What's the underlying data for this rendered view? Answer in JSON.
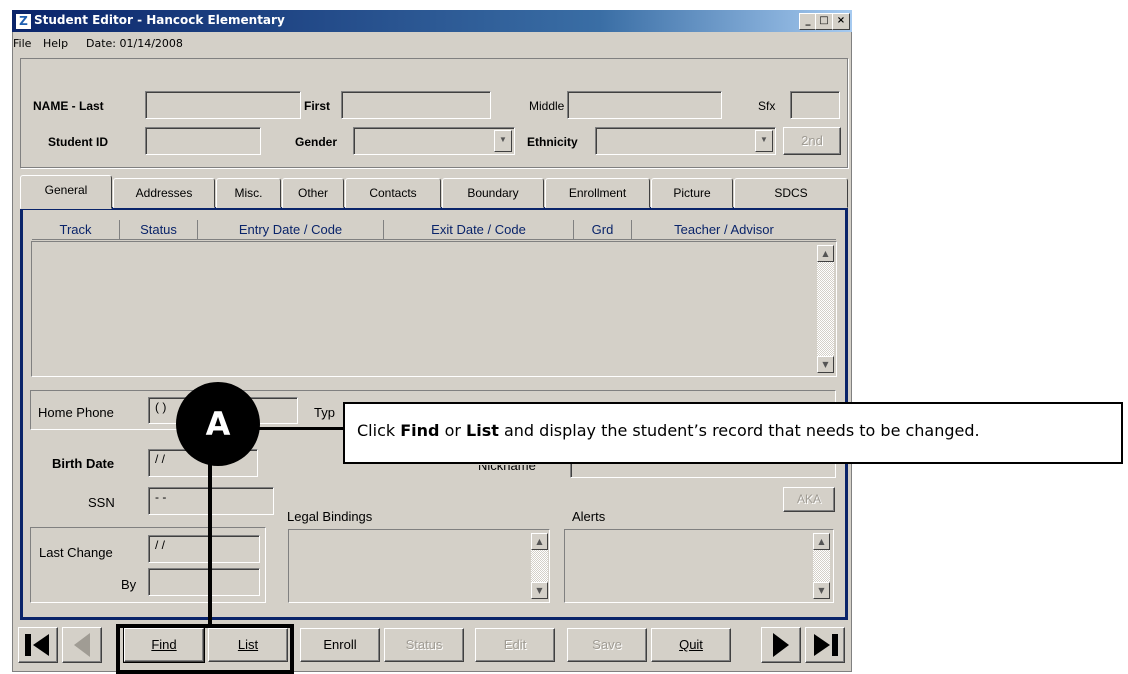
{
  "window": {
    "title": "Student Editor - Hancock Elementary",
    "app_icon": "Z"
  },
  "menu": {
    "file": "File",
    "help": "Help",
    "date": "Date: 01/14/2008"
  },
  "name_row": {
    "last_label": "NAME - Last",
    "first_label": "First",
    "middle_label": "Middle",
    "sfx_label": "Sfx"
  },
  "id_row": {
    "student_id_label": "Student ID",
    "gender_label": "Gender",
    "ethnicity_label": "Ethnicity",
    "second_button": "2nd"
  },
  "tabs": [
    "General",
    "Addresses",
    "Misc.",
    "Other",
    "Contacts",
    "Boundary",
    "Enrollment",
    "Picture",
    "SDCS"
  ],
  "table": {
    "columns": [
      "Track",
      "Status",
      "Entry Date / Code",
      "Exit Date / Code",
      "Grd",
      "Teacher / Advisor"
    ]
  },
  "general": {
    "home_phone_label": "Home Phone",
    "home_phone_value": "(  )",
    "type_label": "Typ",
    "birth_date_label": "Birth Date",
    "birth_date_value": "/ /",
    "ssn_label": "SSN",
    "ssn_value": "- -",
    "nickname_label": "Nickname",
    "aka_button": "AKA",
    "legal_bindings_label": "Legal Bindings",
    "alerts_label": "Alerts",
    "last_change_label": "Last Change",
    "last_change_value": "/ /",
    "by_label": "By"
  },
  "buttons": {
    "find": "Find",
    "list": "List",
    "enroll": "Enroll",
    "status": "Status",
    "edit": "Edit",
    "save": "Save",
    "quit": "Quit"
  },
  "callout": {
    "marker": "A",
    "pre": "Click ",
    "find": "Find",
    "mid": " or ",
    "list": "List",
    "post": " and display the student’s record that needs to be changed."
  },
  "colors": {
    "window_bg": "#d4d0c8",
    "title_bar": "#0a246a",
    "tab_border": "#0a246a"
  }
}
